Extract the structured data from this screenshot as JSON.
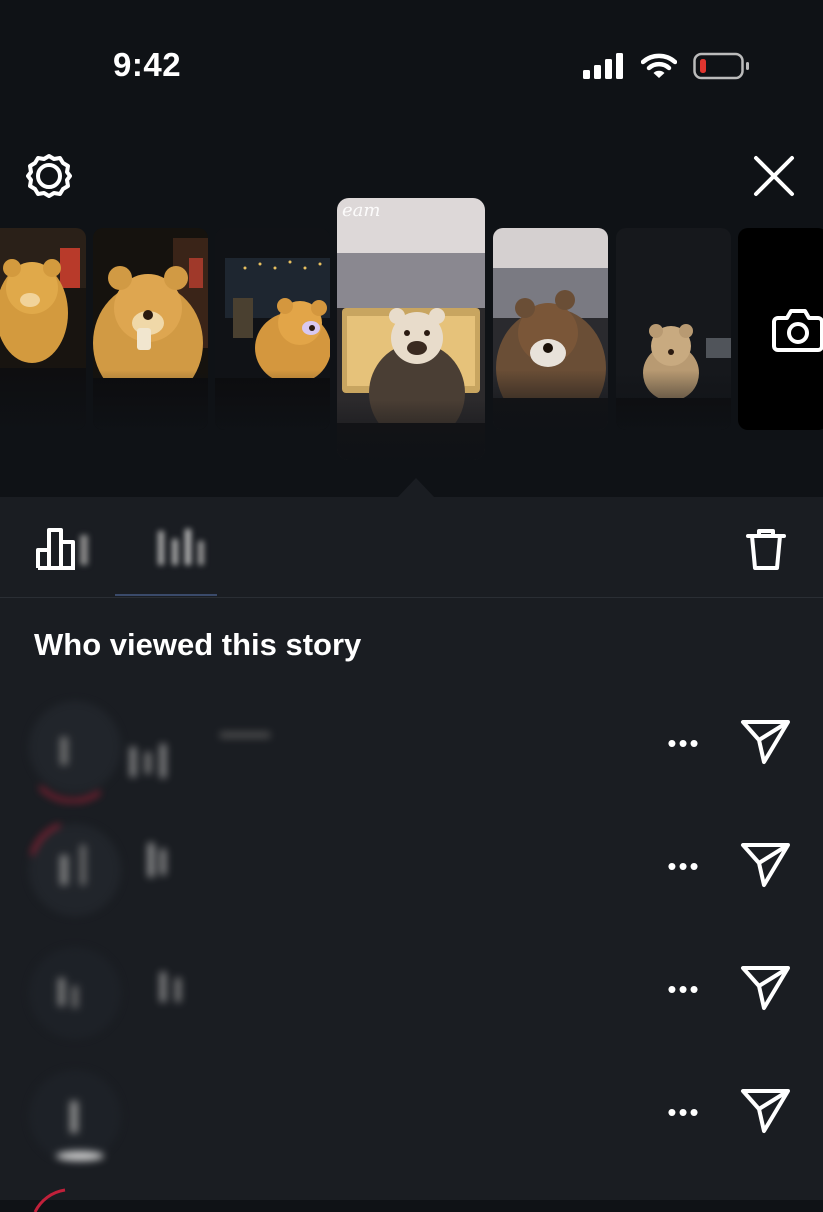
{
  "status_bar": {
    "time": "9:42",
    "icons": [
      "cellular-signal-icon",
      "wifi-icon",
      "battery-low-icon"
    ],
    "battery_color": "#e0352f"
  },
  "toolbar": {
    "left_icon": "settings-gear-icon",
    "right_icon": "close-icon"
  },
  "carousel": {
    "thumbnails": [
      {
        "label": "story-1"
      },
      {
        "label": "story-2"
      },
      {
        "label": "story-3"
      },
      {
        "label": "story-4",
        "current": true
      },
      {
        "label": "story-5"
      },
      {
        "label": "story-6"
      }
    ],
    "add_icon": "camera-icon"
  },
  "panel": {
    "insights_icon": "bar-chart-icon",
    "delete_icon": "trash-icon",
    "section_title": "Who viewed this story",
    "viewers": [
      {
        "more_icon": "more-dots-icon",
        "send_icon": "send-icon"
      },
      {
        "more_icon": "more-dots-icon",
        "send_icon": "send-icon"
      },
      {
        "more_icon": "more-dots-icon",
        "send_icon": "send-icon"
      },
      {
        "more_icon": "more-dots-icon",
        "send_icon": "send-icon"
      }
    ],
    "more_label": "•••"
  },
  "colors": {
    "background": "#0f1216",
    "panel": "#1a1d22",
    "text": "#ffffff",
    "story_ring": "#c0203a"
  }
}
